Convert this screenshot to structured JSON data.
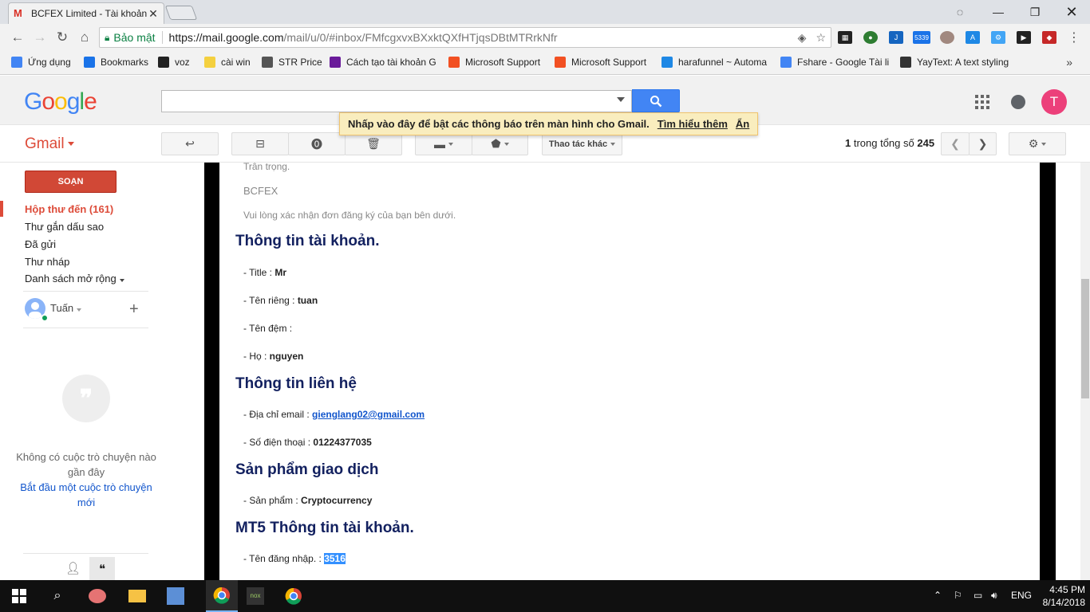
{
  "browser": {
    "tab_title": "BCFEX Limited - Tài khoản",
    "secure_label": "Bảo mật",
    "url_host": "https://mail.google.com",
    "url_path": "/mail/u/0/#inbox/FMfcgxvxBXxktQXfHTjqsDBtMTRrkNfr",
    "ext_badge": "5339",
    "bookmarks": [
      {
        "label": "Ứng dụng",
        "color": "#4285f4"
      },
      {
        "label": "Bookmarks",
        "color": "#1a73e8"
      },
      {
        "label": "voz",
        "color": "#222222"
      },
      {
        "label": "cài win",
        "color": "#f4d03f"
      },
      {
        "label": "STR Price",
        "color": "#555555"
      },
      {
        "label": "Cách tạo tài khoản G",
        "color": "#6a1b9a"
      },
      {
        "label": "Microsoft Support",
        "color": "#f25022"
      },
      {
        "label": "Microsoft Support",
        "color": "#f25022"
      },
      {
        "label": "harafunnel ~ Automa",
        "color": "#1e88e5"
      },
      {
        "label": "Fshare - Google Tài li",
        "color": "#4285f4"
      },
      {
        "label": "YayText: A text styling",
        "color": "#333333"
      }
    ]
  },
  "gmail": {
    "logo": "Google",
    "app_menu": "Gmail",
    "avatar_letter": "T",
    "notification": {
      "text": "Nhấp vào đây để bật các thông báo trên màn hình cho Gmail.",
      "learn_more": "Tìm hiểu thêm",
      "hide": "Ẩn"
    },
    "toolbar": {
      "more_actions": "Thao tác khác",
      "pager_current": "1",
      "pager_middle": " trong tổng số ",
      "pager_total": "245"
    },
    "nav": {
      "compose": "SOẠN",
      "items": [
        "Hộp thư đến (161)",
        "Thư gắn dấu sao",
        "Đã gửi",
        "Thư nháp",
        "Danh sách mở rộng"
      ],
      "user_name": "Tuấn",
      "hangouts_empty": "Không có cuộc trò chuyện nào gần đây",
      "hangouts_start": "Bắt đầu một cuộc trò chuyện mới"
    }
  },
  "email": {
    "greeting": "Trân trọng.",
    "signature": "BCFEX",
    "confirm_note": "Vui lòng xác nhận đơn đăng ký của bạn bên dưới.",
    "section_account": "Thông tin tài khoản.",
    "title_label": "- Title : ",
    "title_value": "Mr",
    "firstname_label": "- Tên riêng : ",
    "firstname_value": "tuan",
    "middlename_label": "- Tên đệm :",
    "lastname_label": "- Họ : ",
    "lastname_value": "nguyen",
    "section_contact": "Thông tin liên hệ",
    "email_label": "- Địa chỉ email : ",
    "email_value": "gienglang02@gmail.com",
    "phone_label": "- Số điện thoại : ",
    "phone_value": "01224377035",
    "section_product": "Sản phẩm giao dịch",
    "product_label": "- Sản phẩm : ",
    "product_value": "Cryptocurrency",
    "section_mt5": "MT5 Thông tin tài khoản.",
    "login_label": "- Tên đăng nhập. : ",
    "login_value": "3516"
  },
  "taskbar": {
    "language": "ENG",
    "time": "4:45 PM",
    "date": "8/14/2018"
  }
}
